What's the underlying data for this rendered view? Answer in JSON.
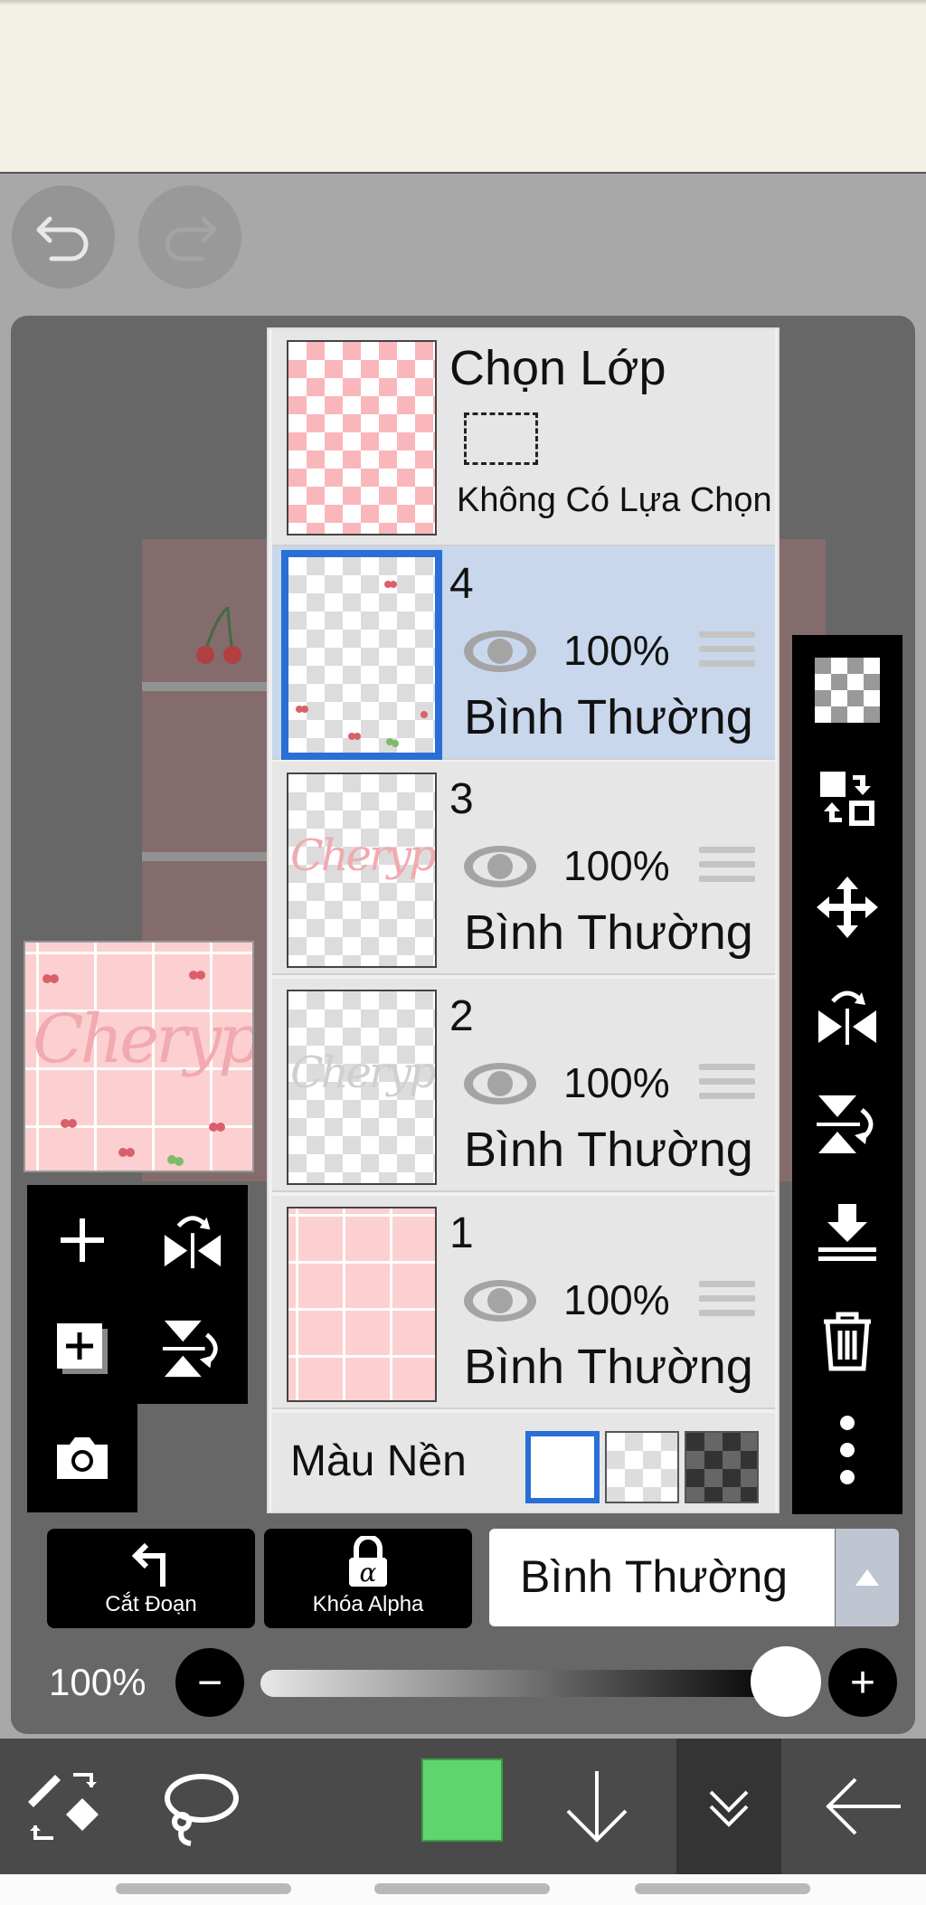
{
  "layer_panel": {
    "select_layer": {
      "title": "Chọn Lớp",
      "status": "Không Có Lựa Chọn"
    },
    "layers": [
      {
        "number": "4",
        "opacity": "100%",
        "blend": "Bình Thường",
        "selected": true
      },
      {
        "number": "3",
        "opacity": "100%",
        "blend": "Bình Thường",
        "thumb_text": "Cherypi"
      },
      {
        "number": "2",
        "opacity": "100%",
        "blend": "Bình Thường",
        "thumb_text": "Cherypi"
      },
      {
        "number": "1",
        "opacity": "100%",
        "blend": "Bình Thường"
      }
    ],
    "background_label": "Màu Nền"
  },
  "preview_text": "Cherypi",
  "bottom_controls": {
    "clip_label": "Cắt Đoạn",
    "alpha_lock_label": "Khóa Alpha",
    "blend_mode": "Bình Thường",
    "opacity_label": "100%",
    "minus": "−",
    "plus": "+"
  },
  "colors": {
    "current_color": "#60d56f",
    "selection_blue": "#2a6fd6",
    "selected_row": "#c8d7ec"
  }
}
